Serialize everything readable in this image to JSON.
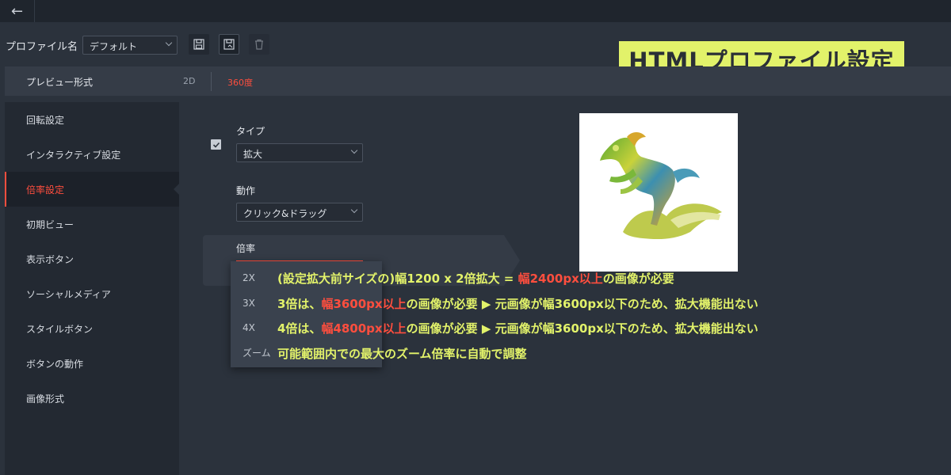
{
  "topbar": {
    "back_icon": "arrow-left-icon"
  },
  "profile": {
    "label": "プロファイル名",
    "selected": "デフォルト",
    "actions": [
      "save-icon",
      "save-as-icon",
      "delete-icon"
    ]
  },
  "title_badge": "HTMLプロファイル設定",
  "preview": {
    "label": "プレビュー形式",
    "options": [
      "2D",
      "360度"
    ],
    "selected": "360度"
  },
  "sidebar": {
    "items": [
      {
        "label": "回転設定"
      },
      {
        "label": "インタラクティブ設定"
      },
      {
        "label": "倍率設定",
        "active": true
      },
      {
        "label": "初期ビュー"
      },
      {
        "label": "表示ボタン"
      },
      {
        "label": "ソーシャルメディア"
      },
      {
        "label": "スタイルボタン"
      },
      {
        "label": "ボタンの動作"
      },
      {
        "label": "画像形式"
      }
    ]
  },
  "settings": {
    "enabled": true,
    "type_label": "タイプ",
    "type_value": "拡大",
    "action_label": "動作",
    "action_value": "クリック&ドラッグ",
    "zoom_label": "倍率"
  },
  "dropdown": {
    "options": [
      "2X",
      "3X",
      "4X",
      "ズーム"
    ]
  },
  "notes": {
    "n1_a": "(設定拡大前サイズの)幅1200 x 2倍拡大 = ",
    "n1_red": "幅2400px以上",
    "n1_b": "の画像が必要",
    "n2_a": "3倍は、",
    "n2_red": "幅3600px以上",
    "n2_b": "の画像が必要 ▶ 元画像が幅3600px以下のため、拡大機能出ない",
    "n3_a": "4倍は、",
    "n3_red": "幅4800px以上",
    "n3_b": "の画像が必要 ▶ 元画像が幅3600px以下のため、拡大機能出ない",
    "n4": "可能範囲内での最大のズーム倍率に自動で調整"
  },
  "colors": {
    "accent": "#ff4e3e",
    "highlight": "#e2f26a",
    "background": "#2b323c",
    "sidebar": "#232932"
  }
}
